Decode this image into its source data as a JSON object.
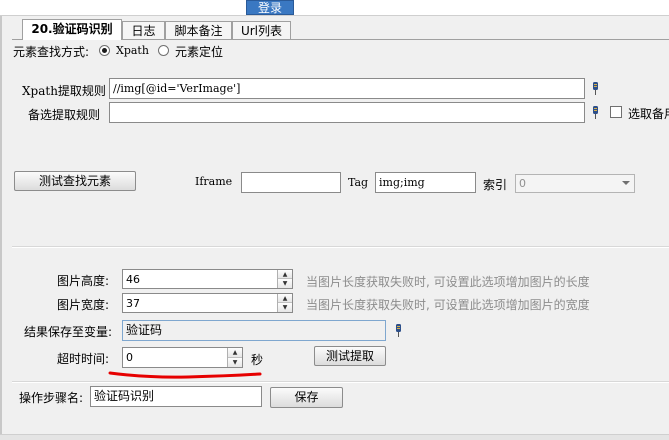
{
  "header": {
    "login_label": "登录"
  },
  "tabs": [
    {
      "label": "20.验证码识别",
      "active": true
    },
    {
      "label": "日志",
      "active": false
    },
    {
      "label": "脚本备注",
      "active": false
    },
    {
      "label": "Url列表",
      "active": false
    }
  ],
  "locate": {
    "label": "元素查找方式:",
    "options": [
      {
        "label": "Xpath",
        "selected": true
      },
      {
        "label": "元素定位",
        "selected": false
      }
    ]
  },
  "xpath": {
    "label": "Xpath提取规则",
    "value": "//img[@id='VerImage']"
  },
  "backup": {
    "label": "备选提取规则",
    "value": "",
    "checkbox_label": "选取备用",
    "checked": false
  },
  "test_find": {
    "button_label": "测试查找元素",
    "iframe_label": "Iframe",
    "iframe_value": "",
    "tag_label": "Tag",
    "tag_value": "img;img",
    "index_label": "索引",
    "index_value": "0"
  },
  "image": {
    "height_label": "图片高度:",
    "height_value": "46",
    "height_hint": "当图片长度获取失败时, 可设置此选项增加图片的长度",
    "width_label": "图片宽度:",
    "width_value": "37",
    "width_hint": "当图片长度获取失败时, 可设置此选项增加图片的宽度"
  },
  "result": {
    "label": "结果保存至变量:",
    "value": "验证码"
  },
  "timeout": {
    "label": "超时时间:",
    "value": "0",
    "unit": "秒",
    "test_button": "测试提取"
  },
  "step": {
    "label": "操作步骤名:",
    "value": "验证码识别",
    "save_button": "保存"
  },
  "colors": {
    "accent": "#3a78c2",
    "annotation": "#e60000"
  }
}
